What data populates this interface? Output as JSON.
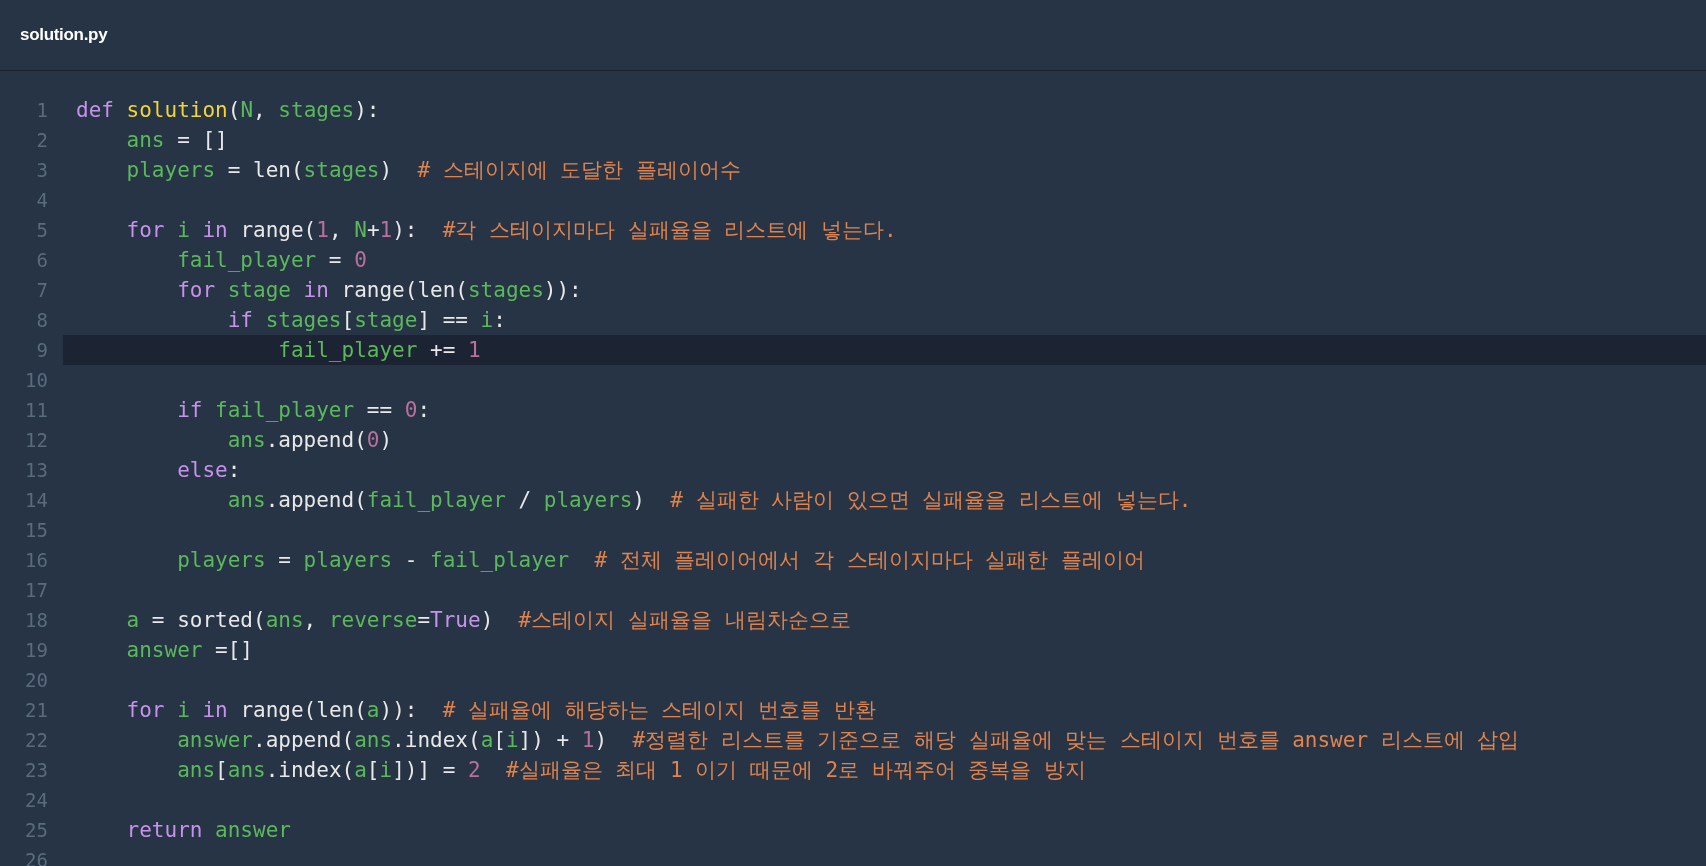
{
  "tab": {
    "title": "solution.py"
  },
  "lines": [
    {
      "number": "1",
      "current": false,
      "tokens": [
        {
          "kind": "kw",
          "text": "def "
        },
        {
          "kind": "fn",
          "text": "solution"
        },
        {
          "kind": "plain",
          "text": "("
        },
        {
          "kind": "var",
          "text": "N"
        },
        {
          "kind": "plain",
          "text": ", "
        },
        {
          "kind": "var",
          "text": "stages"
        },
        {
          "kind": "plain",
          "text": "):"
        }
      ]
    },
    {
      "number": "2",
      "current": false,
      "tokens": [
        {
          "kind": "var",
          "text": "    ans"
        },
        {
          "kind": "plain",
          "text": " = []"
        }
      ]
    },
    {
      "number": "3",
      "current": false,
      "tokens": [
        {
          "kind": "var",
          "text": "    players"
        },
        {
          "kind": "plain",
          "text": " = len("
        },
        {
          "kind": "var",
          "text": "stages"
        },
        {
          "kind": "plain",
          "text": ")  "
        },
        {
          "kind": "comment",
          "text": "# 스테이지에 도달한 플레이어수"
        }
      ]
    },
    {
      "number": "4",
      "current": false
    },
    {
      "number": "5",
      "current": false,
      "tokens": [
        {
          "kind": "kw",
          "text": "    for "
        },
        {
          "kind": "var",
          "text": "i "
        },
        {
          "kind": "kw",
          "text": "in"
        },
        {
          "kind": "plain",
          "text": " range("
        },
        {
          "kind": "num",
          "text": "1"
        },
        {
          "kind": "plain",
          "text": ", "
        },
        {
          "kind": "var",
          "text": "N"
        },
        {
          "kind": "plain",
          "text": "+"
        },
        {
          "kind": "num",
          "text": "1"
        },
        {
          "kind": "plain",
          "text": "):  "
        },
        {
          "kind": "comment",
          "text": "#각 스테이지마다 실패율을 리스트에 넣는다."
        }
      ]
    },
    {
      "number": "6",
      "current": false,
      "tokens": [
        {
          "kind": "var",
          "text": "        fail_player"
        },
        {
          "kind": "plain",
          "text": " = "
        },
        {
          "kind": "num",
          "text": "0"
        }
      ]
    },
    {
      "number": "7",
      "current": false,
      "tokens": [
        {
          "kind": "kw",
          "text": "        for "
        },
        {
          "kind": "var",
          "text": "stage "
        },
        {
          "kind": "kw",
          "text": "in"
        },
        {
          "kind": "plain",
          "text": " range(len("
        },
        {
          "kind": "var",
          "text": "stages"
        },
        {
          "kind": "plain",
          "text": ")):"
        }
      ]
    },
    {
      "number": "8",
      "current": false,
      "tokens": [
        {
          "kind": "kw",
          "text": "            if "
        },
        {
          "kind": "var",
          "text": "stages"
        },
        {
          "kind": "plain",
          "text": "["
        },
        {
          "kind": "var",
          "text": "stage"
        },
        {
          "kind": "plain",
          "text": "] == "
        },
        {
          "kind": "var",
          "text": "i"
        },
        {
          "kind": "plain",
          "text": ":"
        }
      ]
    },
    {
      "number": "9",
      "current": true,
      "tokens": [
        {
          "kind": "var",
          "text": "                fail_player"
        },
        {
          "kind": "plain",
          "text": " += "
        },
        {
          "kind": "num",
          "text": "1"
        }
      ]
    },
    {
      "number": "10",
      "current": false
    },
    {
      "number": "11",
      "current": false,
      "tokens": [
        {
          "kind": "kw",
          "text": "        if "
        },
        {
          "kind": "var",
          "text": "fail_player"
        },
        {
          "kind": "plain",
          "text": " == "
        },
        {
          "kind": "num",
          "text": "0"
        },
        {
          "kind": "plain",
          "text": ":"
        }
      ]
    },
    {
      "number": "12",
      "current": false,
      "tokens": [
        {
          "kind": "var",
          "text": "            ans"
        },
        {
          "kind": "plain",
          "text": ".append("
        },
        {
          "kind": "num",
          "text": "0"
        },
        {
          "kind": "plain",
          "text": ")"
        }
      ]
    },
    {
      "number": "13",
      "current": false,
      "tokens": [
        {
          "kind": "kw",
          "text": "        else"
        },
        {
          "kind": "plain",
          "text": ":"
        }
      ]
    },
    {
      "number": "14",
      "current": false,
      "tokens": [
        {
          "kind": "var",
          "text": "            ans"
        },
        {
          "kind": "plain",
          "text": ".append("
        },
        {
          "kind": "var",
          "text": "fail_player"
        },
        {
          "kind": "plain",
          "text": " / "
        },
        {
          "kind": "var",
          "text": "players"
        },
        {
          "kind": "plain",
          "text": ")  "
        },
        {
          "kind": "comment",
          "text": "# 실패한 사람이 있으면 실패율을 리스트에 넣는다."
        }
      ]
    },
    {
      "number": "15",
      "current": false
    },
    {
      "number": "16",
      "current": false,
      "tokens": [
        {
          "kind": "var",
          "text": "        players"
        },
        {
          "kind": "plain",
          "text": " = "
        },
        {
          "kind": "var",
          "text": "players"
        },
        {
          "kind": "plain",
          "text": " - "
        },
        {
          "kind": "var",
          "text": "fail_player"
        },
        {
          "kind": "comment",
          "text": "  # 전체 플레이어에서 각 스테이지마다 실패한 플레이어"
        }
      ]
    },
    {
      "number": "17",
      "current": false
    },
    {
      "number": "18",
      "current": false,
      "tokens": [
        {
          "kind": "var",
          "text": "    a"
        },
        {
          "kind": "plain",
          "text": " = sorted("
        },
        {
          "kind": "var",
          "text": "ans"
        },
        {
          "kind": "plain",
          "text": ", "
        },
        {
          "kind": "var",
          "text": "reverse"
        },
        {
          "kind": "plain",
          "text": "="
        },
        {
          "kind": "kw",
          "text": "True"
        },
        {
          "kind": "plain",
          "text": ")  "
        },
        {
          "kind": "comment",
          "text": "#스테이지 실패율을 내림차순으로"
        }
      ]
    },
    {
      "number": "19",
      "current": false,
      "tokens": [
        {
          "kind": "var",
          "text": "    answer"
        },
        {
          "kind": "plain",
          "text": " =[]"
        }
      ]
    },
    {
      "number": "20",
      "current": false
    },
    {
      "number": "21",
      "current": false,
      "tokens": [
        {
          "kind": "kw",
          "text": "    for "
        },
        {
          "kind": "var",
          "text": "i "
        },
        {
          "kind": "kw",
          "text": "in"
        },
        {
          "kind": "plain",
          "text": " range(len("
        },
        {
          "kind": "var",
          "text": "a"
        },
        {
          "kind": "plain",
          "text": ")):  "
        },
        {
          "kind": "comment",
          "text": "# 실패율에 해당하는 스테이지 번호를 반환"
        }
      ]
    },
    {
      "number": "22",
      "current": false,
      "tokens": [
        {
          "kind": "var",
          "text": "        answer"
        },
        {
          "kind": "plain",
          "text": ".append("
        },
        {
          "kind": "var",
          "text": "ans"
        },
        {
          "kind": "plain",
          "text": ".index("
        },
        {
          "kind": "var",
          "text": "a"
        },
        {
          "kind": "plain",
          "text": "["
        },
        {
          "kind": "var",
          "text": "i"
        },
        {
          "kind": "plain",
          "text": "]) + "
        },
        {
          "kind": "num",
          "text": "1"
        },
        {
          "kind": "plain",
          "text": ")  "
        },
        {
          "kind": "comment",
          "text": "#정렬한 리스트를 기준으로 해당 실패율에 맞는 스테이지 번호를 answer 리스트에 삽입"
        }
      ]
    },
    {
      "number": "23",
      "current": false,
      "tokens": [
        {
          "kind": "var",
          "text": "        ans"
        },
        {
          "kind": "plain",
          "text": "["
        },
        {
          "kind": "var",
          "text": "ans"
        },
        {
          "kind": "plain",
          "text": ".index("
        },
        {
          "kind": "var",
          "text": "a"
        },
        {
          "kind": "plain",
          "text": "["
        },
        {
          "kind": "var",
          "text": "i"
        },
        {
          "kind": "plain",
          "text": "])] = "
        },
        {
          "kind": "num",
          "text": "2"
        },
        {
          "kind": "comment",
          "text": "  #실패율은 최대 1 이기 때문에 2로 바꿔주어 중복을 방지"
        }
      ]
    },
    {
      "number": "24",
      "current": false
    },
    {
      "number": "25",
      "current": false,
      "tokens": [
        {
          "kind": "kw",
          "text": "    return "
        },
        {
          "kind": "var",
          "text": "answer"
        }
      ]
    },
    {
      "number": "26",
      "current": false
    }
  ]
}
